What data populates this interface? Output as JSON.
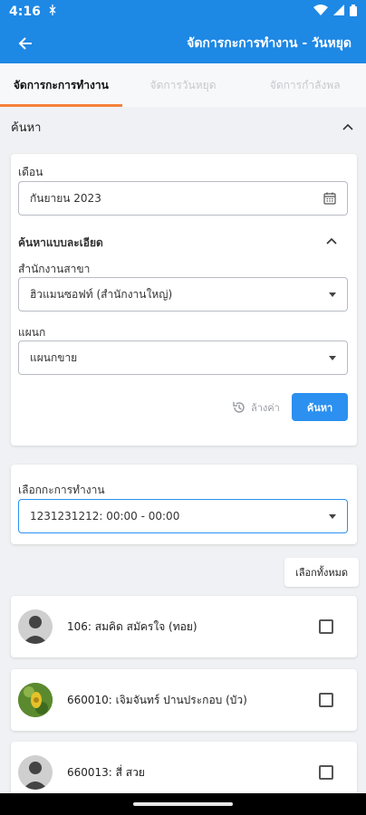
{
  "status": {
    "time": "4:16"
  },
  "appbar": {
    "title": "จัดการกะการทำงาน - วันหยุด"
  },
  "tabs": [
    {
      "label": "จัดการกะการทำงาน"
    },
    {
      "label": "จัดการวันหยุด"
    },
    {
      "label": "จัดการกำลังพล"
    }
  ],
  "search": {
    "header": "ค้นหา",
    "month_label": "เดือน",
    "month_value": "กันยายน 2023",
    "detail_header": "ค้นหาแบบละเอียด",
    "branch_label": "สำนักงานสาขา",
    "branch_value": "ฮิวแมนซอฟท์ (สำนักงานใหญ่)",
    "dept_label": "แผนก",
    "dept_value": "แผนกขาย",
    "reset_label": "ล้างค่า",
    "search_button": "ค้นหา"
  },
  "shift": {
    "label": "เลือกกะการทำงาน",
    "value": "1231231212: 00:00 - 00:00"
  },
  "select_all_label": "เลือกทั้งหมด",
  "employees": [
    {
      "name": "106: สมคิด สมัครใจ (ทอย)"
    },
    {
      "name": "660010: เจิมจันทร์ ปานประกอบ (บัว)"
    },
    {
      "name": "660013: สี่ สวย"
    }
  ]
}
